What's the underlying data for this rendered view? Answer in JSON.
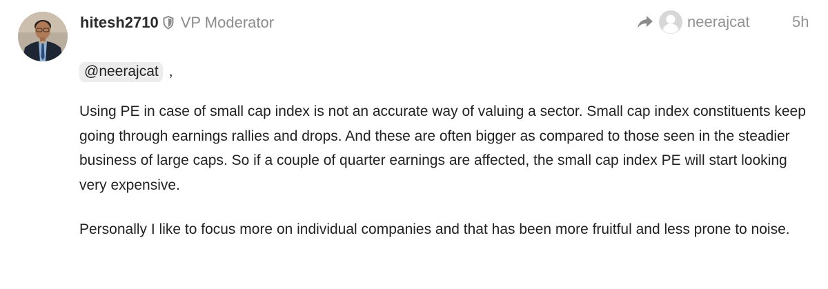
{
  "post": {
    "author": {
      "username": "hitesh2710",
      "title": "VP Moderator"
    },
    "reply_to": {
      "username": "neerajcat"
    },
    "time_ago": "5h",
    "mention": "@neerajcat",
    "mention_suffix": ",",
    "paragraphs": [
      "Using PE in case of small cap index is not an accurate way of valuing a sector. Small cap index constituents keep going through earnings rallies and drops. And these are often bigger as compared to those seen in the steadier business of large caps. So if a couple of quarter earnings are affected, the small cap index PE will start looking very expensive.",
      "Personally I like to focus more on individual companies and that has been more fruitful and less prone to noise."
    ]
  },
  "icons": {
    "moderator": "shield-icon",
    "reply": "reply-arrow-icon",
    "reply_user": "default-avatar-icon",
    "author_avatar": "user-photo"
  },
  "colors": {
    "text": "#222222",
    "muted": "#929292",
    "mention_bg": "#ececec"
  }
}
